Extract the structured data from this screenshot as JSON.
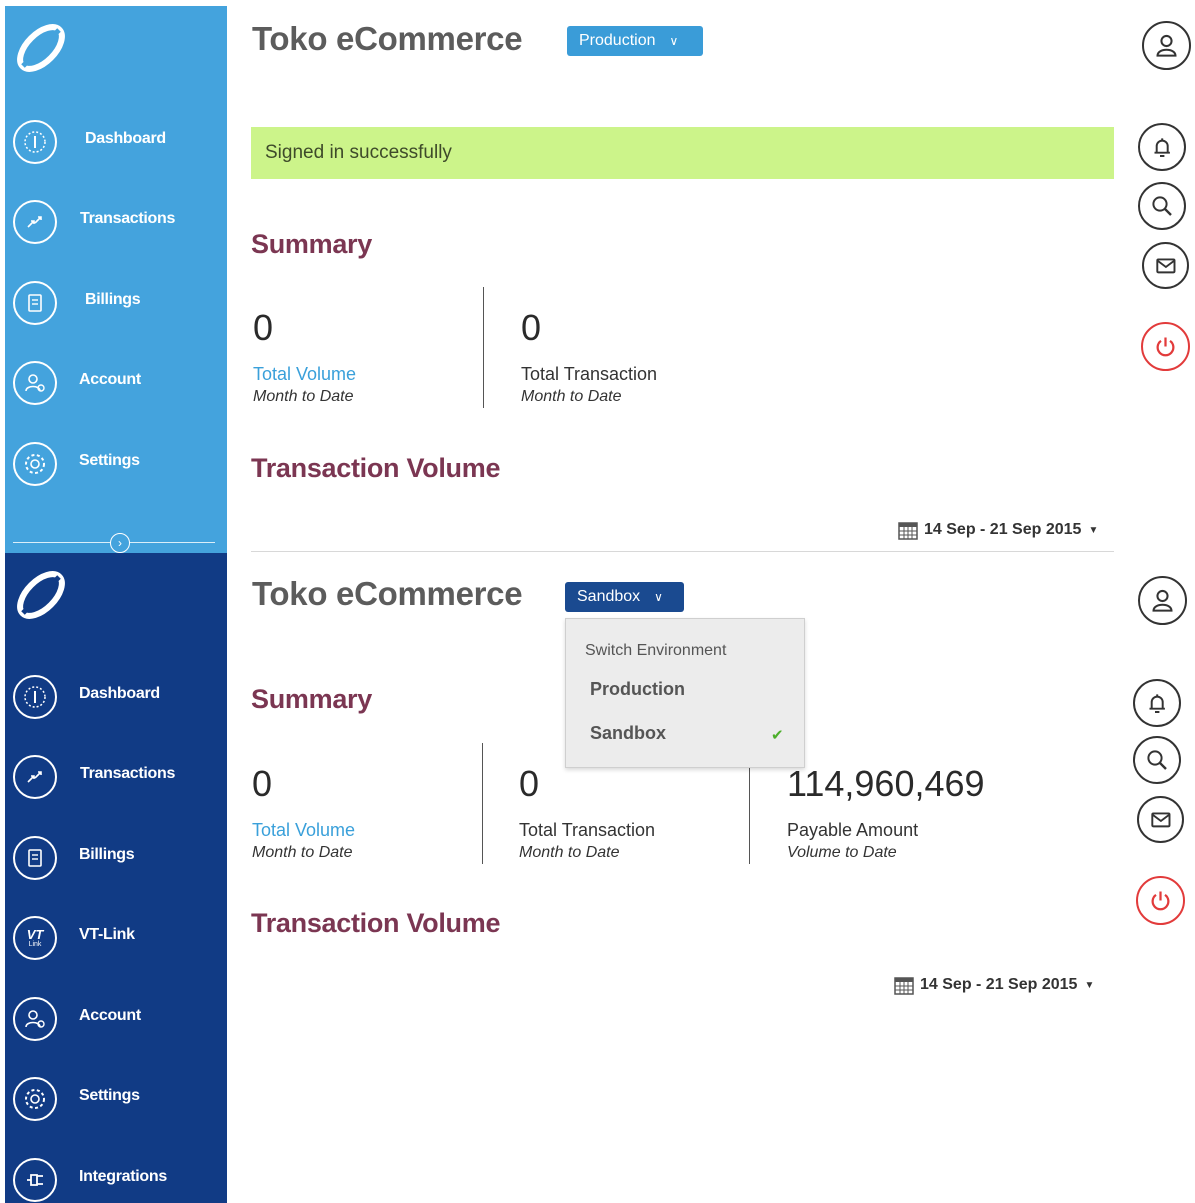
{
  "top_panel": {
    "app_title": "Toko eCommerce",
    "environment_button": "Production",
    "alert": "Signed in successfully",
    "nav": [
      "Dashboard",
      "Transactions",
      "Billings",
      "Account",
      "Settings"
    ],
    "summary_title": "Summary",
    "stats": [
      {
        "value": "0",
        "label": "Total Volume",
        "sub": "Month to Date"
      },
      {
        "value": "0",
        "label": "Total Transaction",
        "sub": "Month to Date"
      }
    ],
    "volume_title": "Transaction Volume",
    "date_range": "14 Sep - 21 Sep 2015"
  },
  "bottom_panel": {
    "app_title": "Toko eCommerce",
    "environment_button": "Sandbox",
    "dropdown": {
      "header": "Switch Environment",
      "options": [
        "Production",
        "Sandbox"
      ],
      "selected": "Sandbox"
    },
    "nav": [
      "Dashboard",
      "Transactions",
      "Billings",
      "VT-Link",
      "Account",
      "Settings",
      "Integrations"
    ],
    "vt_icon": {
      "top": "VT",
      "bottom": "Link"
    },
    "summary_title": "Summary",
    "stats": [
      {
        "value": "0",
        "label": "Total Volume",
        "sub": "Month to Date"
      },
      {
        "value": "0",
        "label": "Total Transaction",
        "sub": "Month to Date"
      },
      {
        "value": "114,960,469",
        "label": "Payable Amount",
        "sub": "Volume to Date"
      }
    ],
    "volume_title": "Transaction Volume",
    "date_range": "14 Sep - 21 Sep 2015"
  },
  "icons": {
    "logo": "swoosh-logo-icon",
    "dashboard": "gauge-icon",
    "transactions": "arrows-icon",
    "billings": "invoice-icon",
    "vt_link": "vt-link-icon",
    "account": "user-gear-icon",
    "settings": "gear-icon",
    "integrations": "plug-icon",
    "profile": "user-icon",
    "notifications": "bell-icon",
    "search": "search-icon",
    "messages": "mail-icon",
    "logout": "power-icon",
    "calendar": "calendar-icon"
  },
  "colors": {
    "sidebar_production": "#44a3dd",
    "sidebar_sandbox": "#113b85",
    "env_production": "#3a9cd8",
    "env_sandbox": "#1a4a90",
    "alert_bg": "#ccf48a",
    "section_title": "#7b3652",
    "link_blue": "#3aa0da",
    "power_red": "#e23b3b",
    "check_green": "#4caf2a"
  }
}
